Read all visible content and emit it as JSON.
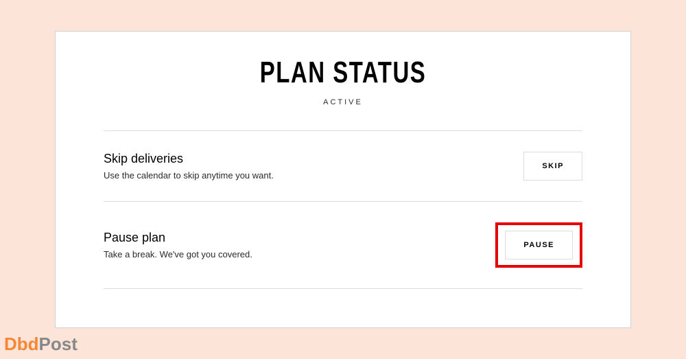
{
  "header": {
    "title": "PLAN STATUS",
    "status": "ACTIVE"
  },
  "rows": [
    {
      "title": "Skip deliveries",
      "subtitle": "Use the calendar to skip anytime you want.",
      "button_label": "SKIP",
      "highlighted": false
    },
    {
      "title": "Pause plan",
      "subtitle": "Take a break. We've got you covered.",
      "button_label": "PAUSE",
      "highlighted": true
    }
  ],
  "watermark": {
    "part1": "Dbd",
    "part2": "Post"
  }
}
